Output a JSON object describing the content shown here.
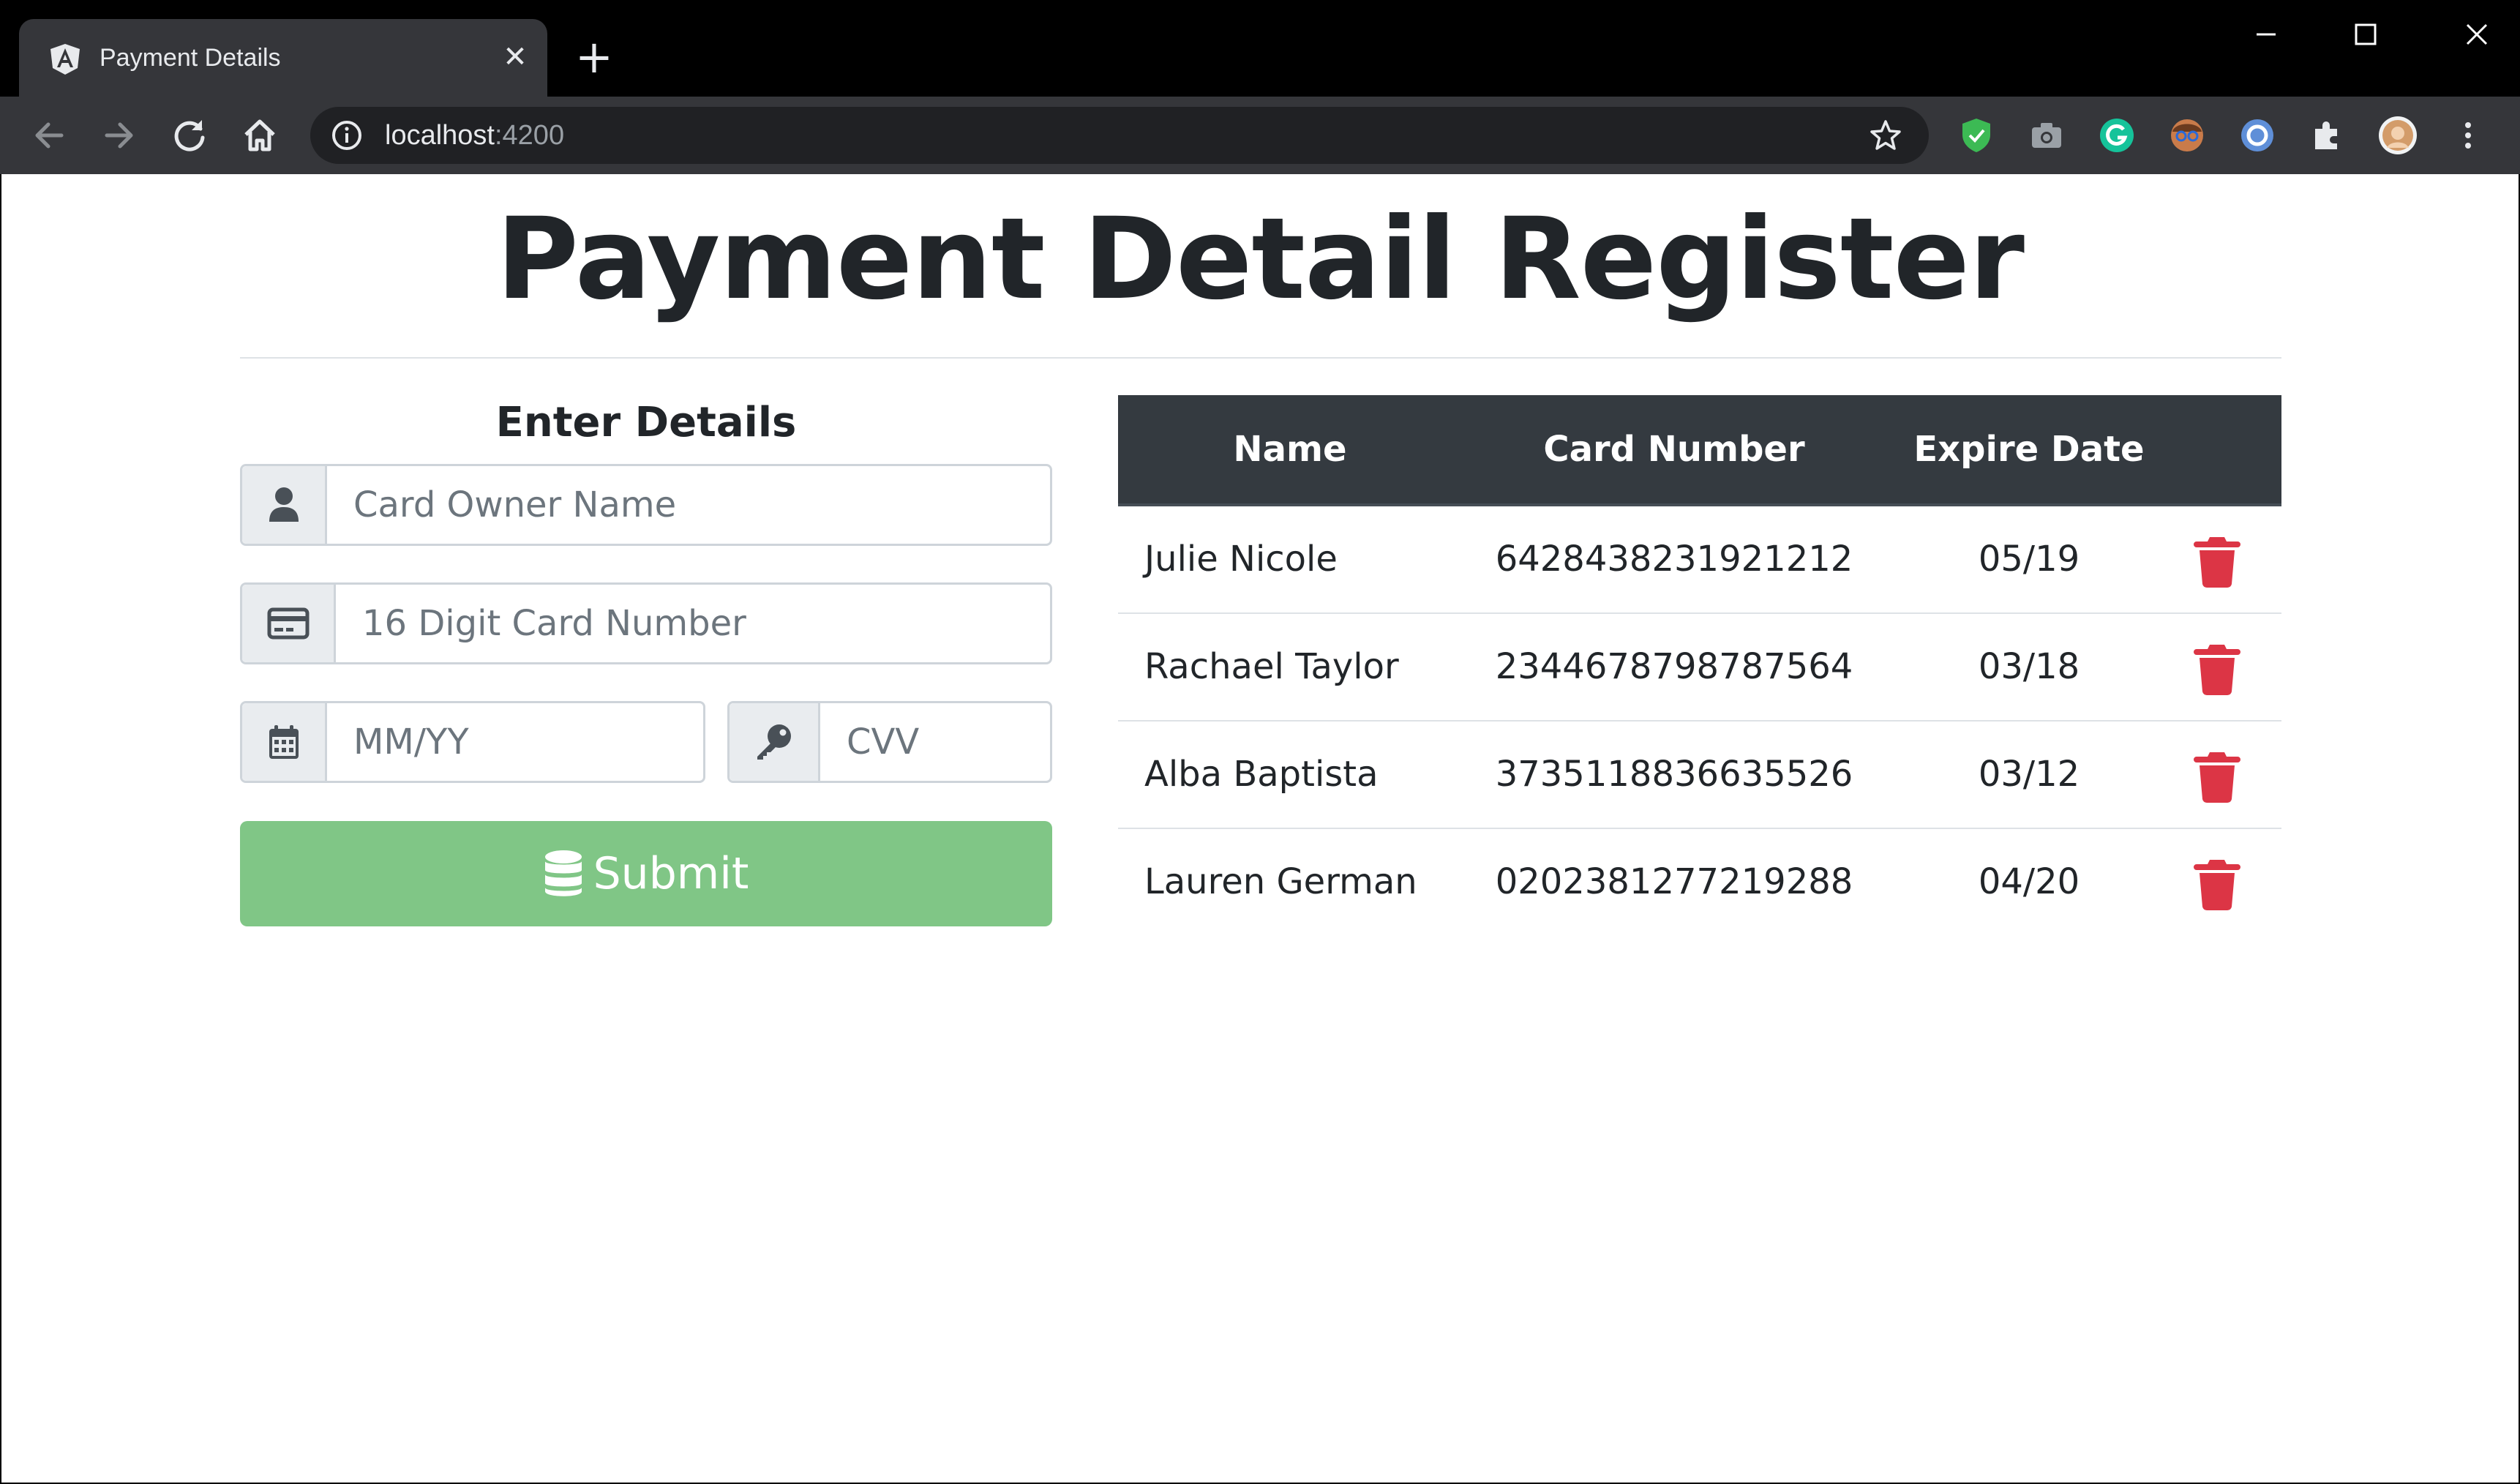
{
  "browser": {
    "tab_title": "Payment Details",
    "tab_close": "✕",
    "new_tab": "+",
    "url_host": "localhost",
    "url_port": ":4200"
  },
  "page": {
    "title": "Payment Detail Register"
  },
  "form": {
    "heading": "Enter Details",
    "owner_placeholder": "Card Owner Name",
    "card_placeholder": "16 Digit Card Number",
    "expiry_placeholder": "MM/YY",
    "cvv_placeholder": "CVV",
    "submit_label": "Submit"
  },
  "table": {
    "headers": [
      "Name",
      "Card Number",
      "Expire Date"
    ],
    "rows": [
      {
        "name": "Julie Nicole",
        "card": "6428438231921212",
        "expiry": "05/19"
      },
      {
        "name": "Rachael Taylor",
        "card": "2344678798787564",
        "expiry": "03/18"
      },
      {
        "name": "Alba Baptista",
        "card": "3735118836635526",
        "expiry": "03/12"
      },
      {
        "name": "Lauren German",
        "card": "0202381277219288",
        "expiry": "04/20"
      }
    ]
  },
  "colors": {
    "submit": "#80c686",
    "delete": "#dc3545",
    "table_header": "#343a40"
  }
}
